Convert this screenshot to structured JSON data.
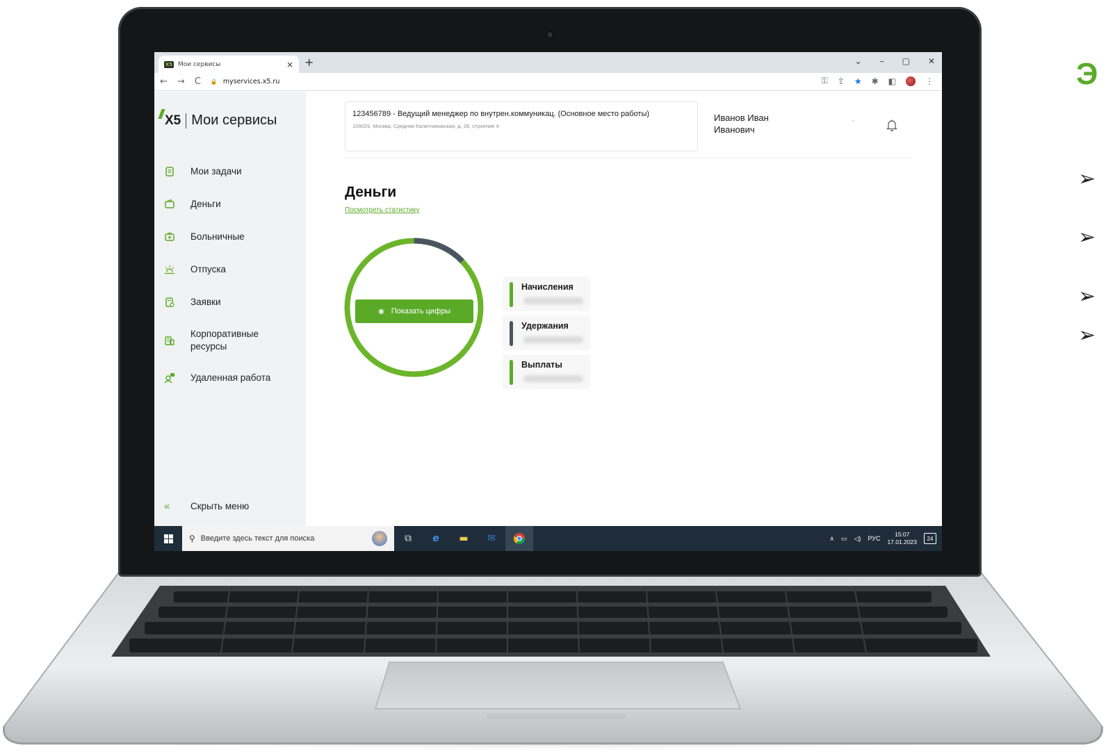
{
  "browser": {
    "tab_title": "Мои сервисы",
    "tab_close": "×",
    "new_tab": "+",
    "url": "myservices.x5.ru",
    "win_min": "–",
    "win_max": "▢",
    "win_close": "✕",
    "win_dropdown": "⌄"
  },
  "app": {
    "logo_mark": "X5",
    "logo_name": "Мои сервисы",
    "nav": [
      {
        "label": "Мои задачи",
        "icon": "tasks-icon"
      },
      {
        "label": "Деньги",
        "icon": "wallet-icon"
      },
      {
        "label": "Больничные",
        "icon": "medical-case-icon"
      },
      {
        "label": "Отпуска",
        "icon": "sun-icon"
      },
      {
        "label": "Заявки",
        "icon": "request-icon"
      },
      {
        "label": "Корпоративные ресурсы",
        "icon": "corporate-resources-icon"
      },
      {
        "label": "Удаленная работа",
        "icon": "remote-work-icon"
      }
    ],
    "hide_menu": "Скрыть меню"
  },
  "header": {
    "job_title": "123456789 - Ведущий менеджер по внутрен.коммуникац. (Основное место работы)",
    "job_address": "109029, Москва, Средняя Калитниковская, д. 28, строение 4",
    "user_name": "Иванов Иван Иванович"
  },
  "main": {
    "title": "Деньги",
    "stats_link": "Посмотреть статистику",
    "show_button": "Показать цифры",
    "legend": [
      {
        "label": "Начисления",
        "color": "#5aaa28"
      },
      {
        "label": "Удержания",
        "color": "#4a5561"
      },
      {
        "label": "Выплаты",
        "color": "#5aaa28"
      }
    ]
  },
  "taskbar": {
    "search_placeholder": "Введите здесь текст для поиска",
    "lang": "РУС",
    "time": "15:07",
    "date": "17.01.2023",
    "notifications": "24"
  },
  "colors": {
    "accent": "#5aaa28",
    "dark_segment": "#4a5561",
    "taskbar": "#1f2d3a"
  }
}
